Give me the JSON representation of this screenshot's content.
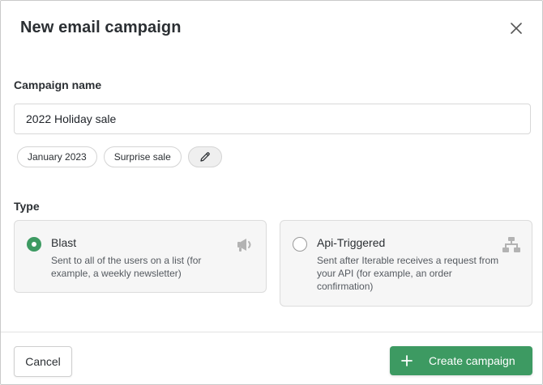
{
  "modal": {
    "title": "New email campaign",
    "close_icon": "close-icon"
  },
  "campaign_name": {
    "label": "Campaign name",
    "value": "2022 Holiday sale"
  },
  "tags": {
    "items": [
      "January 2023",
      "Surprise sale"
    ],
    "edit_icon": "pencil-icon"
  },
  "type": {
    "label": "Type",
    "options": [
      {
        "title": "Blast",
        "description": "Sent to all of the users on a list (for example, a weekly newsletter)",
        "selected": true,
        "icon": "megaphone-icon"
      },
      {
        "title": "Api-Triggered",
        "description": "Sent after Iterable receives a request from your API (for example, an order confirmation)",
        "selected": false,
        "icon": "workflow-icon"
      }
    ]
  },
  "footer": {
    "cancel_label": "Cancel",
    "create_label": "Create campaign",
    "create_icon": "plus-icon"
  },
  "colors": {
    "accent": "#3d9a62",
    "card_background": "#f6f6f6",
    "border": "#dcdcdc"
  }
}
